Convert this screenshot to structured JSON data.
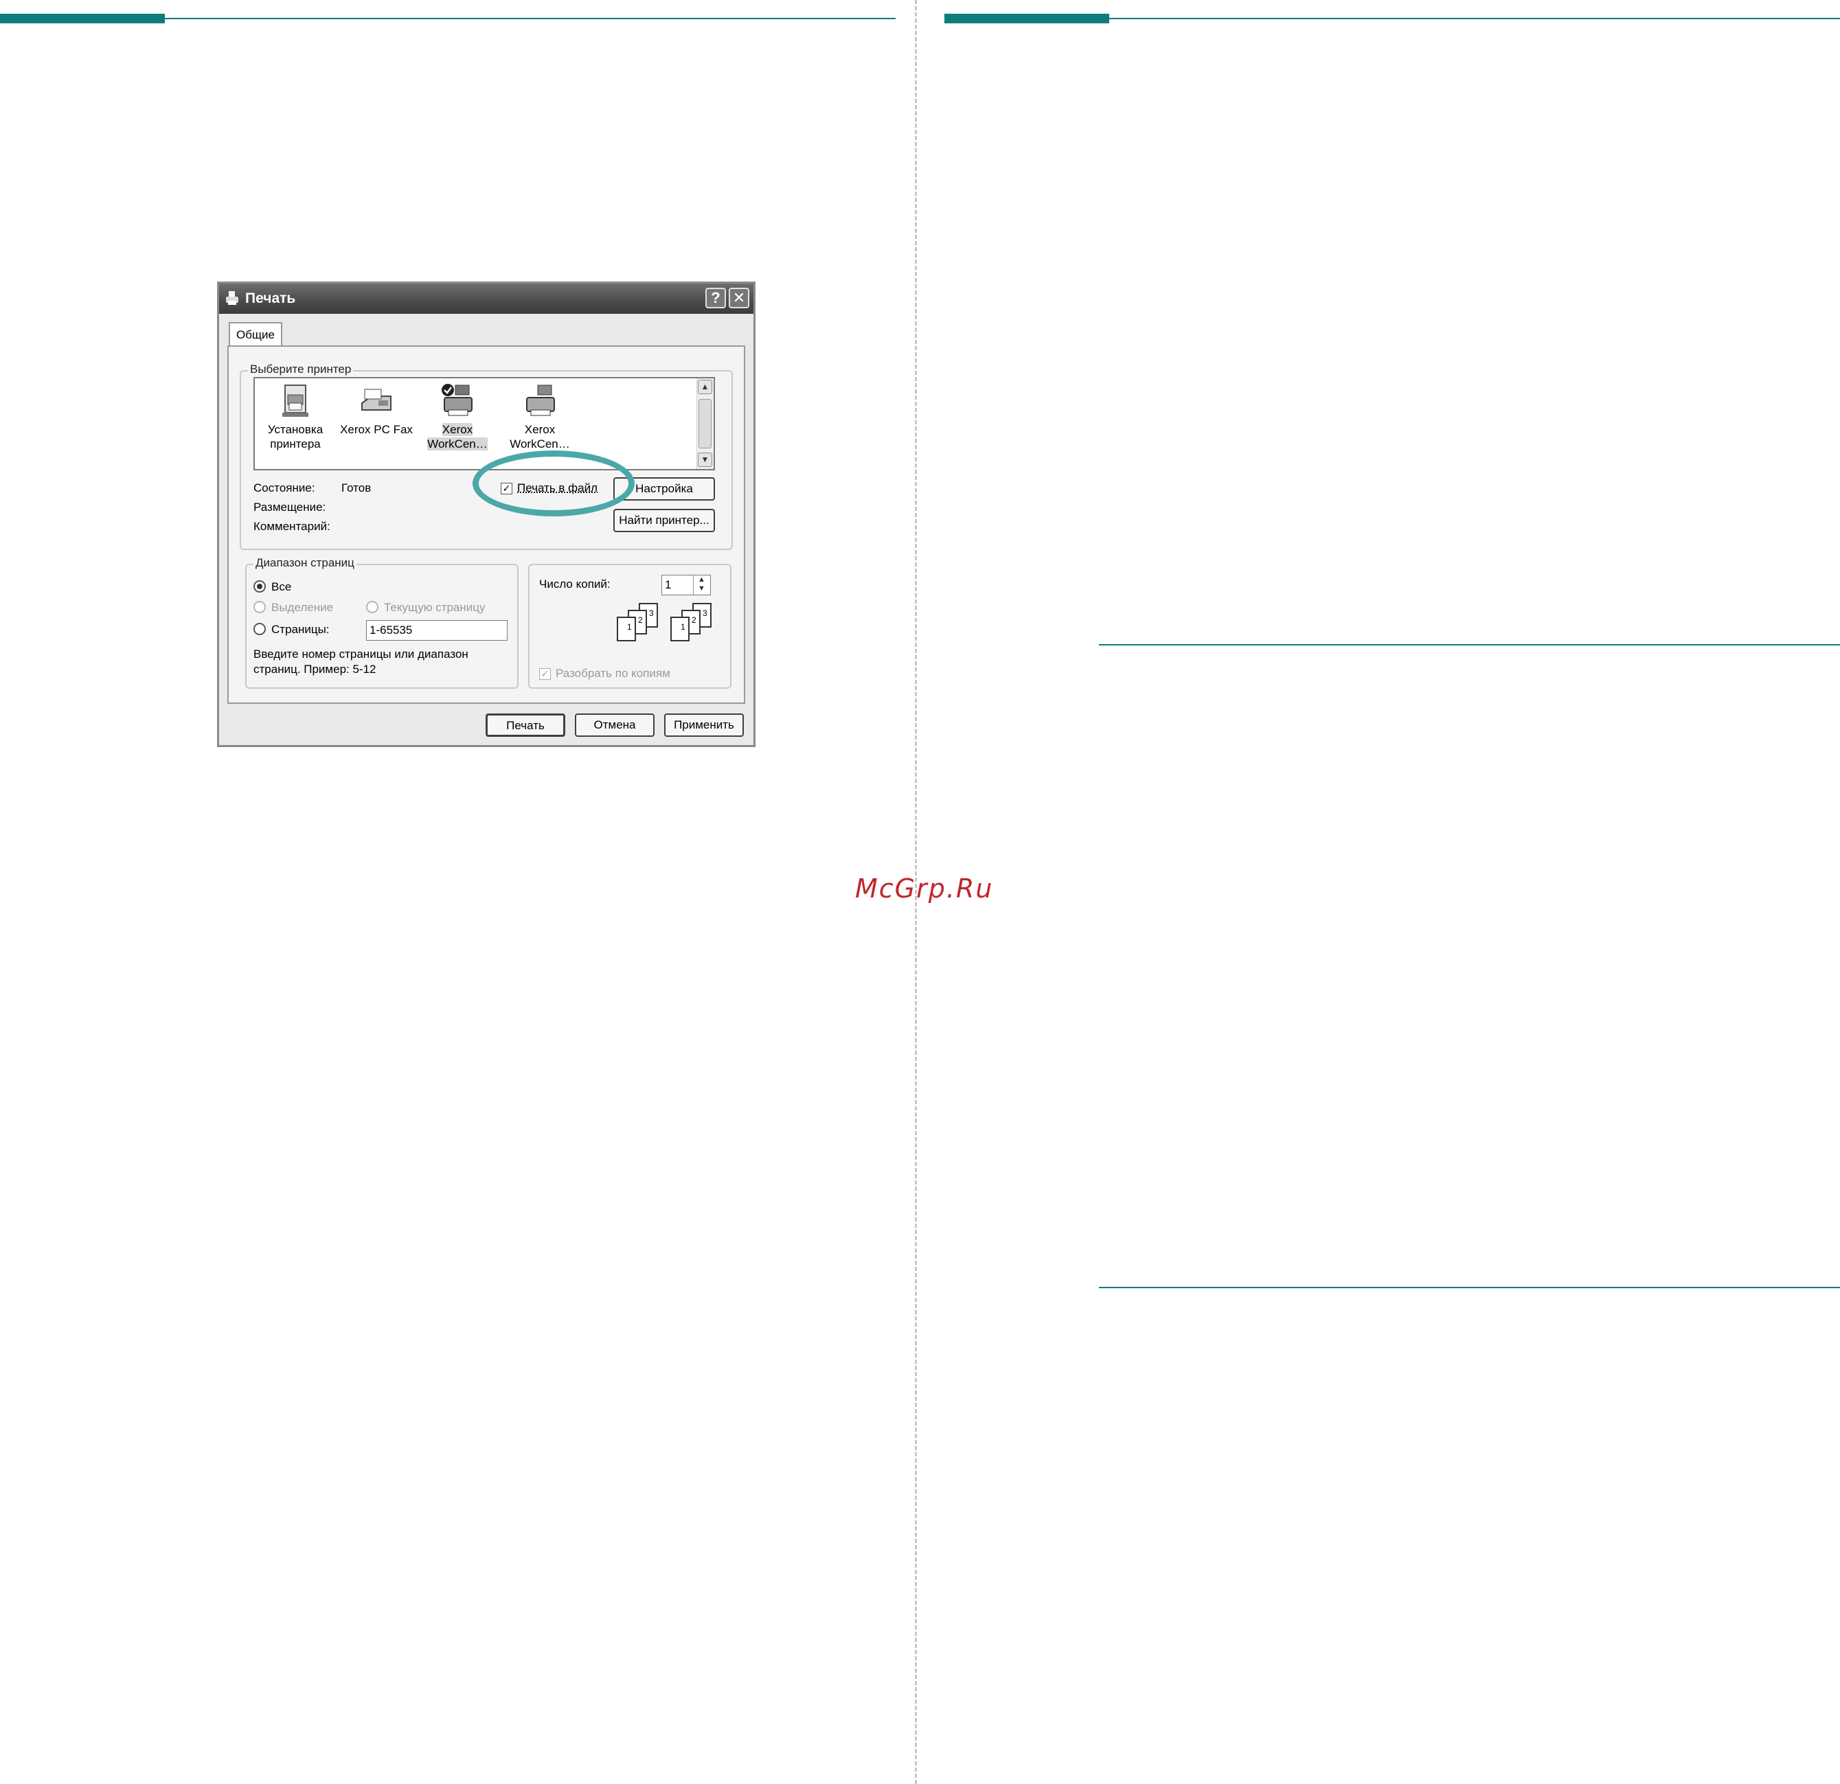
{
  "page": {
    "watermark": "McGrp.Ru",
    "accent_color": "#0e7c7b",
    "ring_color": "#4aa8a8"
  },
  "dialog": {
    "title": "Печать",
    "title_icon": "printer-icon",
    "help_button": "?",
    "close_button": "✕",
    "tab_general": "Общие",
    "select_printer_legend": "Выберите принтер",
    "printers": [
      {
        "line1": "Установка",
        "line2": "принтера",
        "icon": "add-printer-icon",
        "selected": false
      },
      {
        "line1": "Xerox PC Fax",
        "line2": "",
        "icon": "fax-icon",
        "selected": false
      },
      {
        "line1": "Xerox",
        "line2": "WorkCen…",
        "icon": "default-printer-icon",
        "selected": true
      },
      {
        "line1": "Xerox",
        "line2": "WorkCen…",
        "icon": "printer-icon",
        "selected": false
      }
    ],
    "status_label": "Состояние:",
    "status_value": "Готов",
    "location_label": "Размещение:",
    "comment_label": "Комментарий:",
    "print_to_file_label": "Печать в файл",
    "print_to_file_checked": true,
    "preferences_button": "Настройка",
    "find_printer_button": "Найти принтер...",
    "page_range_legend": "Диапазон страниц",
    "range_all": "Все",
    "range_selection": "Выделение",
    "range_current": "Текущую страницу",
    "range_pages": "Страницы:",
    "range_pages_value": "1-65535",
    "range_hint_line1": "Введите номер страницы или диапазон",
    "range_hint_line2": "страниц.  Пример: 5-12",
    "copies_label": "Число копий:",
    "copies_value": "1",
    "collate_label": "Разобрать по копиям",
    "collate_checked": true,
    "collate_pages": [
      "1",
      "2",
      "3"
    ],
    "print_button": "Печать",
    "cancel_button": "Отмена",
    "apply_button": "Применить"
  }
}
